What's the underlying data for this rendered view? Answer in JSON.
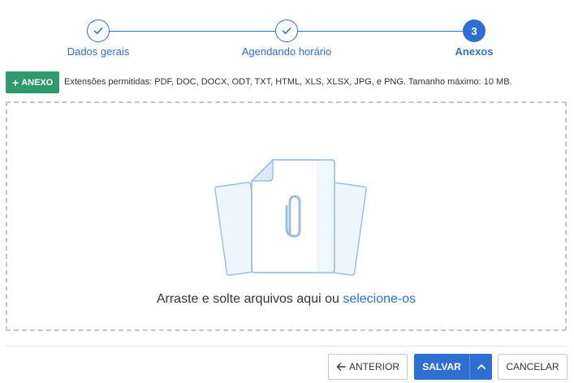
{
  "stepper": {
    "steps": [
      {
        "label": "Dados gerais",
        "status": "done"
      },
      {
        "label": "Agendando horário",
        "status": "done"
      },
      {
        "label": "Anexos",
        "status": "active",
        "number": "3"
      }
    ]
  },
  "attachments": {
    "add_label": "ANEXO",
    "extensions_text": "Extensões permitidas: PDF, DOC, DOCX, ODT, TXT, HTML, XLS, XLSX, JPG, e PNG. Tamanho máximo: 10 MB."
  },
  "dropzone": {
    "text": "Arraste e solte arquivos aqui ou",
    "link": "selecione-os"
  },
  "footer": {
    "prev_label": "ANTERIOR",
    "save_label": "SALVAR",
    "cancel_label": "CANCELAR"
  },
  "colors": {
    "primary": "#2f6fd1",
    "success": "#2e9a6e"
  }
}
